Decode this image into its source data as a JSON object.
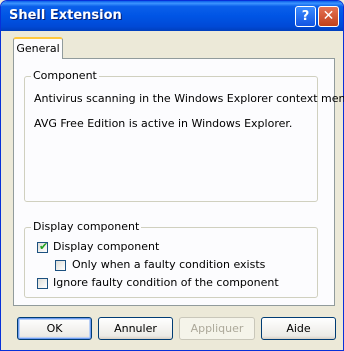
{
  "window": {
    "title": "Shell Extension"
  },
  "titlebar": {
    "help_glyph": "?",
    "close_glyph": "✕",
    "icons": [
      "help-icon",
      "close-icon"
    ]
  },
  "tabs": [
    {
      "label": "General",
      "active": true
    }
  ],
  "component_group": {
    "legend": "Component",
    "lines": [
      "Antivirus scanning in the Windows Explorer context menu.",
      "AVG Free Edition is active in Windows Explorer."
    ]
  },
  "display_group": {
    "legend": "Display component",
    "options": [
      {
        "label": "Display component",
        "checked": true
      },
      {
        "label": "Only when a faulty condition exists",
        "checked": false
      },
      {
        "label": "Ignore faulty condition of the component",
        "checked": false
      }
    ]
  },
  "buttons": {
    "ok": "OK",
    "cancel": "Annuler",
    "apply": "Appliquer",
    "help": "Aide"
  },
  "colors": {
    "titlebar": "#0055e5",
    "dialog_bg": "#ece9d8",
    "panel_bg": "#fcfcfe",
    "tab_highlight": "#ffc83c"
  }
}
